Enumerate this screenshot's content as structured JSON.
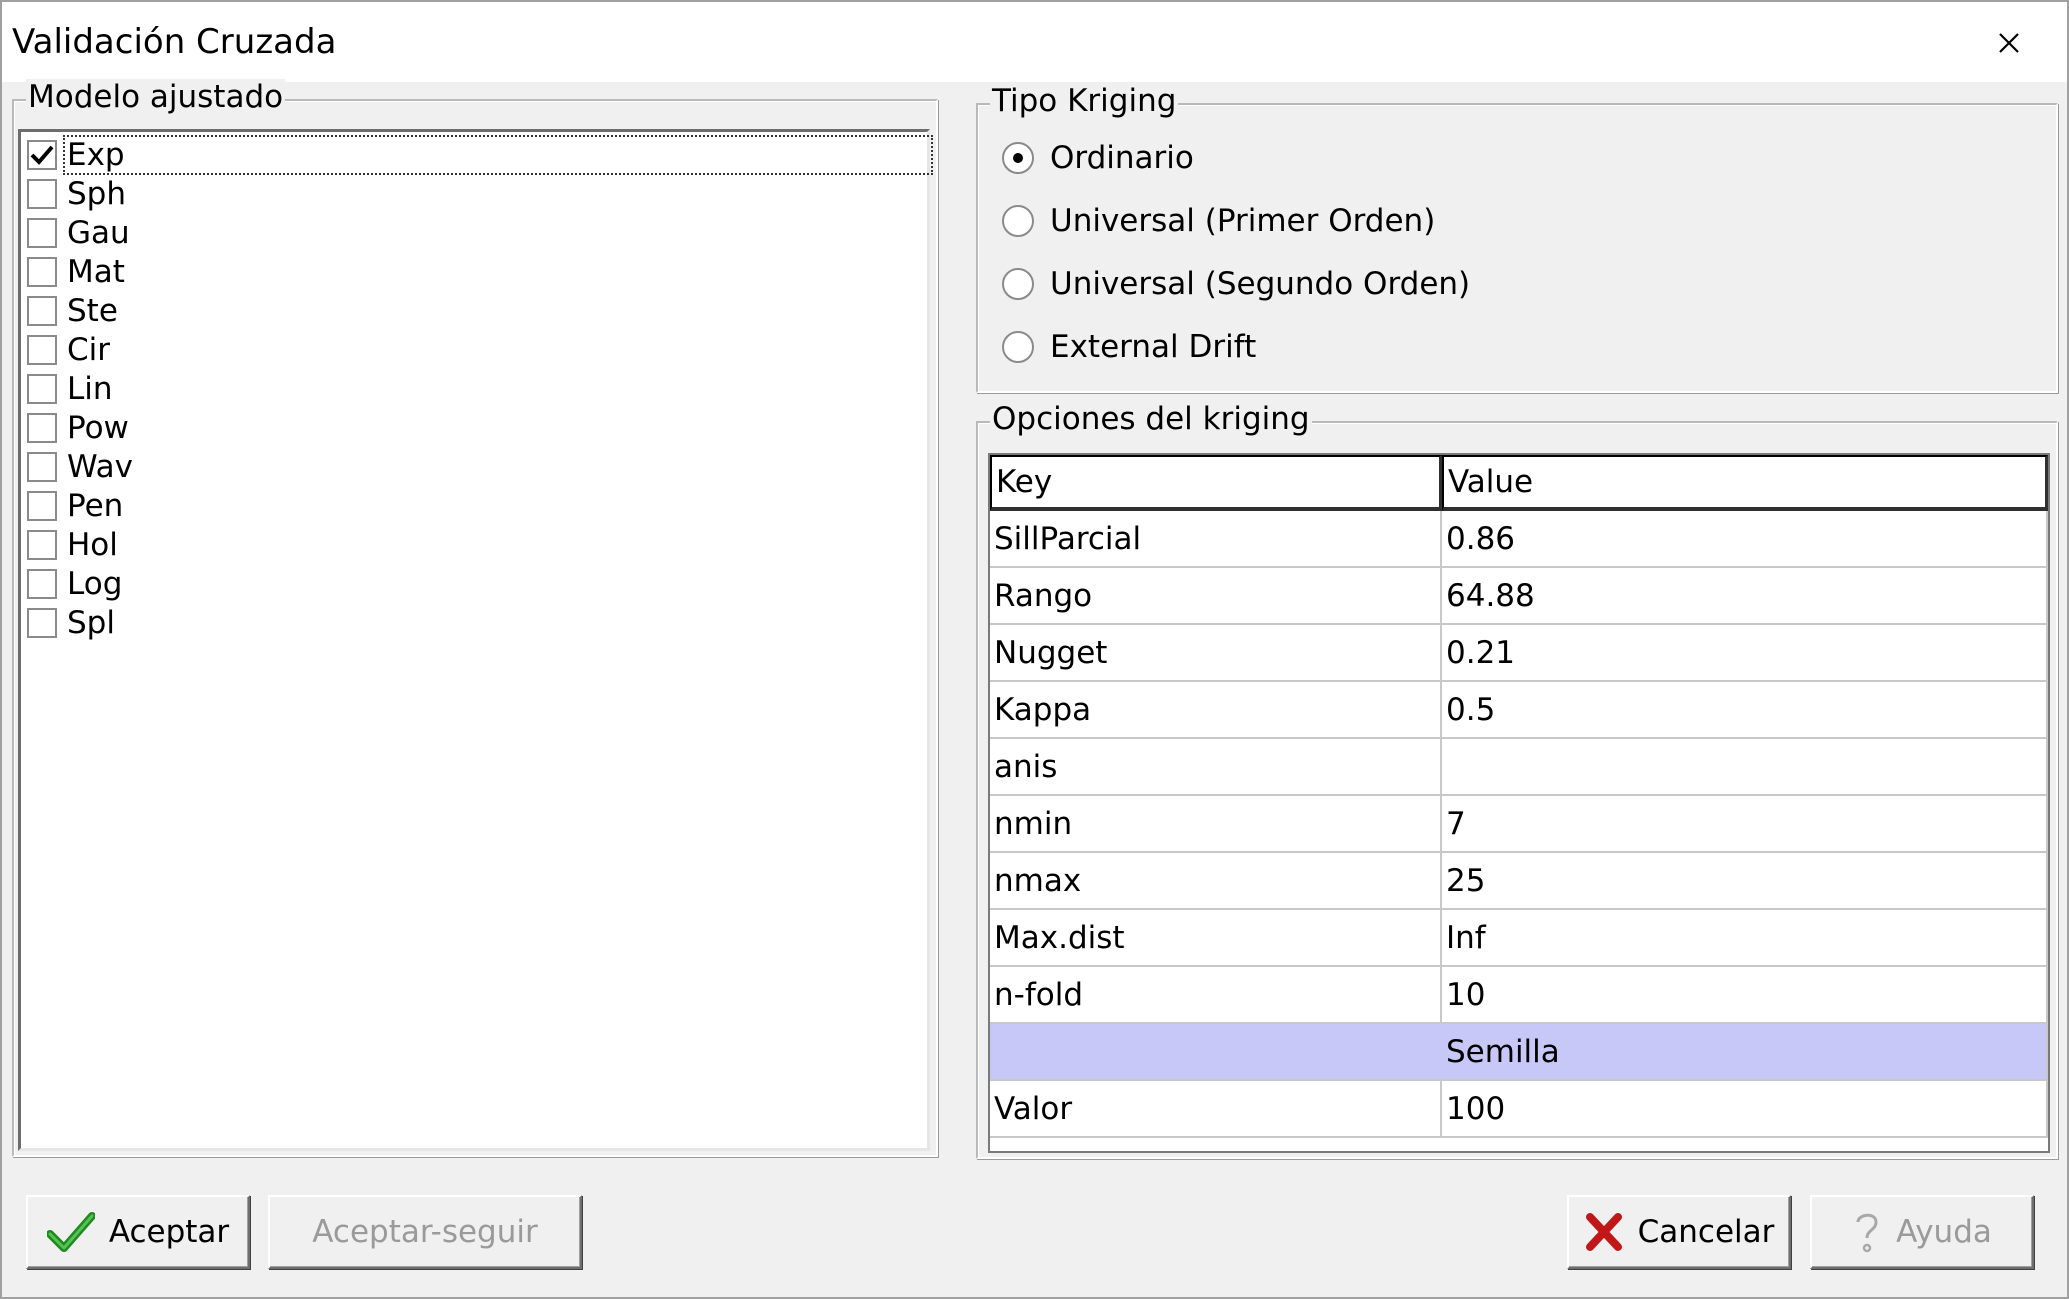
{
  "window": {
    "title": "Validación Cruzada"
  },
  "modelo": {
    "legend": "Modelo ajustado",
    "items": [
      {
        "label": "Exp",
        "checked": true
      },
      {
        "label": "Sph",
        "checked": false
      },
      {
        "label": "Gau",
        "checked": false
      },
      {
        "label": "Mat",
        "checked": false
      },
      {
        "label": "Ste",
        "checked": false
      },
      {
        "label": "Cir",
        "checked": false
      },
      {
        "label": "Lin",
        "checked": false
      },
      {
        "label": "Pow",
        "checked": false
      },
      {
        "label": "Wav",
        "checked": false
      },
      {
        "label": "Pen",
        "checked": false
      },
      {
        "label": "Hol",
        "checked": false
      },
      {
        "label": "Log",
        "checked": false
      },
      {
        "label": "Spl",
        "checked": false
      }
    ]
  },
  "tipo": {
    "legend": "Tipo Kriging",
    "options": [
      {
        "label": "Ordinario",
        "checked": true
      },
      {
        "label": "Universal (Primer Orden)",
        "checked": false
      },
      {
        "label": "Universal (Segundo Orden)",
        "checked": false
      },
      {
        "label": "External Drift",
        "checked": false
      }
    ]
  },
  "opciones": {
    "legend": "Opciones del kriging",
    "headers": {
      "key": "Key",
      "value": "Value"
    },
    "rows": [
      {
        "key": "SillParcial",
        "value": "0.86"
      },
      {
        "key": "Rango",
        "value": "64.88"
      },
      {
        "key": "Nugget",
        "value": "0.21"
      },
      {
        "key": "Kappa",
        "value": "0.5"
      },
      {
        "key": "anis",
        "value": ""
      },
      {
        "key": "nmin",
        "value": "7"
      },
      {
        "key": "nmax",
        "value": "25"
      },
      {
        "key": "Max.dist",
        "value": "Inf"
      },
      {
        "key": "n-fold",
        "value": "10"
      },
      {
        "key": "",
        "value": "Semilla",
        "section": true
      },
      {
        "key": "Valor",
        "value": "100"
      }
    ]
  },
  "buttons": {
    "aceptar": "Aceptar",
    "aceptar_seguir": "Aceptar-seguir",
    "cancelar": "Cancelar",
    "ayuda": "Ayuda"
  },
  "colors": {
    "section_row": "#c8c8f8",
    "accept_icon": "#1f8a1f",
    "cancel_icon": "#c01818"
  },
  "icons": {
    "close": "close-icon",
    "accept": "check-icon",
    "cancel": "x-icon",
    "help": "question-icon"
  }
}
